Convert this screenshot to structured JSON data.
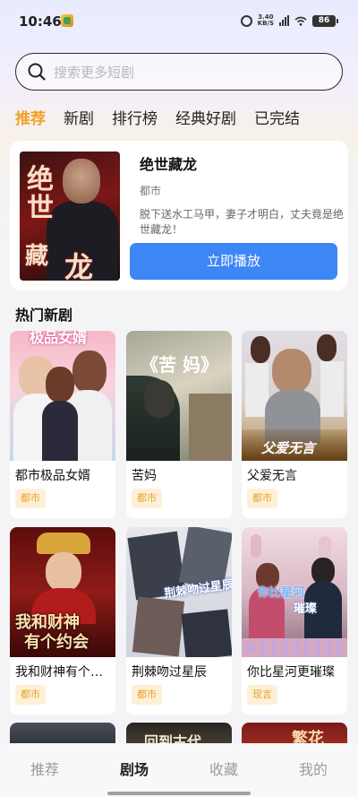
{
  "status": {
    "time": "10:46",
    "speed_top": "3.40",
    "speed_bottom": "KB/S",
    "network": "5G",
    "battery": "86"
  },
  "search": {
    "placeholder": "搜索更多短剧"
  },
  "tabs": [
    {
      "label": "推荐",
      "active": true
    },
    {
      "label": "新剧",
      "active": false
    },
    {
      "label": "排行榜",
      "active": false
    },
    {
      "label": "经典好剧",
      "active": false
    },
    {
      "label": "已完结",
      "active": false
    }
  ],
  "featured": {
    "title": "绝世藏龙",
    "genre": "都市",
    "description": "脱下送水工马甲，妻子才明白，丈夫竟是绝世藏龙！",
    "play_label": "立即播放",
    "poster_text": [
      "绝",
      "世",
      "藏",
      "龙"
    ]
  },
  "hot_section": {
    "title": "热门新剧"
  },
  "dramas": [
    {
      "name": "都市极品女婿",
      "tag": "都市",
      "poster_text": "极品女婿"
    },
    {
      "name": "苦妈",
      "tag": "都市",
      "poster_text": "《苦 妈》"
    },
    {
      "name": "父爱无言",
      "tag": "都市",
      "poster_text": "父爱无言"
    },
    {
      "name": "我和财神有个约会",
      "tag": "都市",
      "poster_text_1": "我和财神",
      "poster_text_2": "有个约会"
    },
    {
      "name": "荆棘吻过星辰",
      "tag": "都市",
      "poster_text": "荆棘吻过星辰"
    },
    {
      "name": "你比星河更璀璨",
      "tag": "现言",
      "poster_text_1": "你比星河",
      "poster_text_2": "璀璨"
    }
  ],
  "peek_posters": [
    "",
    "回到古代",
    "繁花"
  ],
  "bottom_nav": [
    {
      "label": "推荐",
      "active": false
    },
    {
      "label": "剧场",
      "active": true
    },
    {
      "label": "收藏",
      "active": false
    },
    {
      "label": "我的",
      "active": false
    }
  ],
  "colors": {
    "accent": "#f0a227",
    "play_button": "#3d86f5",
    "tag_bg": "#fdf0d6",
    "tag_text": "#e8a12c"
  }
}
